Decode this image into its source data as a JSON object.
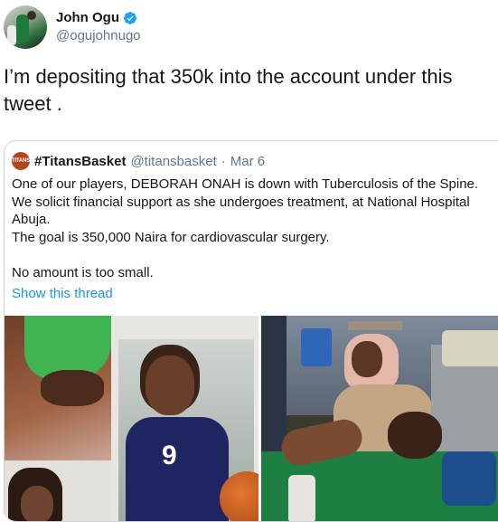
{
  "tweet": {
    "display_name": "John Ogu",
    "handle": "@ogujohnugo",
    "text": "I’m depositing that 350k into the account under this tweet .",
    "verified_color": "#1da1f2"
  },
  "quoted_tweet": {
    "logo_text": "TITANS",
    "display_name": "#TitansBasket",
    "handle": "@titansbasket",
    "separator": "·",
    "date": "Mar 6",
    "lines": [
      "One of our players, DEBORAH ONAH is down with Tuberculosis of the Spine.",
      "We solicit financial support as she undergoes treatment, at National Hospital Abuja.",
      "The goal is 350,000 Naira for cardiovascular surgery."
    ],
    "closing_line": "No amount is too small.",
    "show_thread": "Show this thread",
    "jersey_number": "9",
    "link_color": "#1b95e0"
  }
}
